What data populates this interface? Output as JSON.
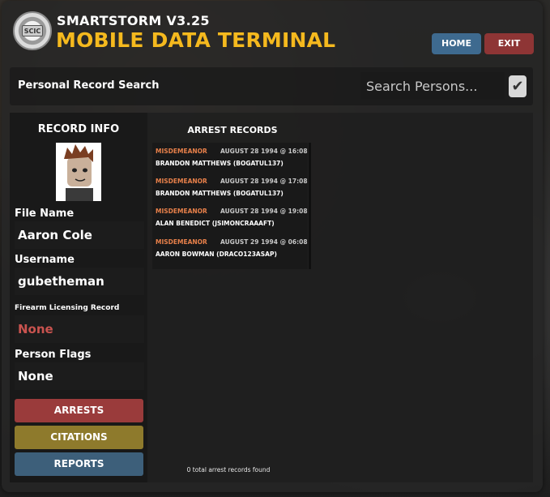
{
  "header": {
    "version": "SMARTSTORM V3.25",
    "title": "MOBILE DATA TERMINAL",
    "logo_text": "SCIC",
    "home_label": "HOME",
    "exit_label": "EXIT"
  },
  "search": {
    "title": "Personal Record Search",
    "placeholder": "Search Persons...",
    "checked": true
  },
  "record_info": {
    "title": "RECORD INFO",
    "file_name_label": "File Name",
    "file_name": "Aaron Cole",
    "username_label": "Username",
    "username": "gubetheman",
    "firearm_label": "Firearm Licensing Record",
    "firearm_value": "None",
    "flags_label": "Person Flags",
    "flags_value": "None"
  },
  "side_buttons": {
    "arrests": "ARRESTS",
    "citations": "CITATIONS",
    "reports": "REPORTS"
  },
  "arrests": {
    "title": "ARREST RECORDS",
    "records": [
      {
        "type": "MISDEMEANOR",
        "date": "AUGUST 28 1994 @ 16:08",
        "name": "BRANDON MATTHEWS (BOGATUL137)"
      },
      {
        "type": "MISDEMEANOR",
        "date": "AUGUST 28 1994 @ 17:08",
        "name": "BRANDON MATTHEWS (BOGATUL137)"
      },
      {
        "type": "MISDEMEANOR",
        "date": "AUGUST 28 1994 @ 19:08",
        "name": "ALAN BENEDICT (JSIMONCRAAAFT)"
      },
      {
        "type": "MISDEMEANOR",
        "date": "AUGUST 29 1994 @ 06:08",
        "name": "AARON BOWMAN (DRACO123ASAP)"
      }
    ],
    "total_text": "0 total arrest records found"
  },
  "colors": {
    "accent_yellow": "#f5b91e",
    "home_blue": "#3e6a8f",
    "exit_red": "#8e3535",
    "misdemeanor_orange": "#e8804a"
  }
}
